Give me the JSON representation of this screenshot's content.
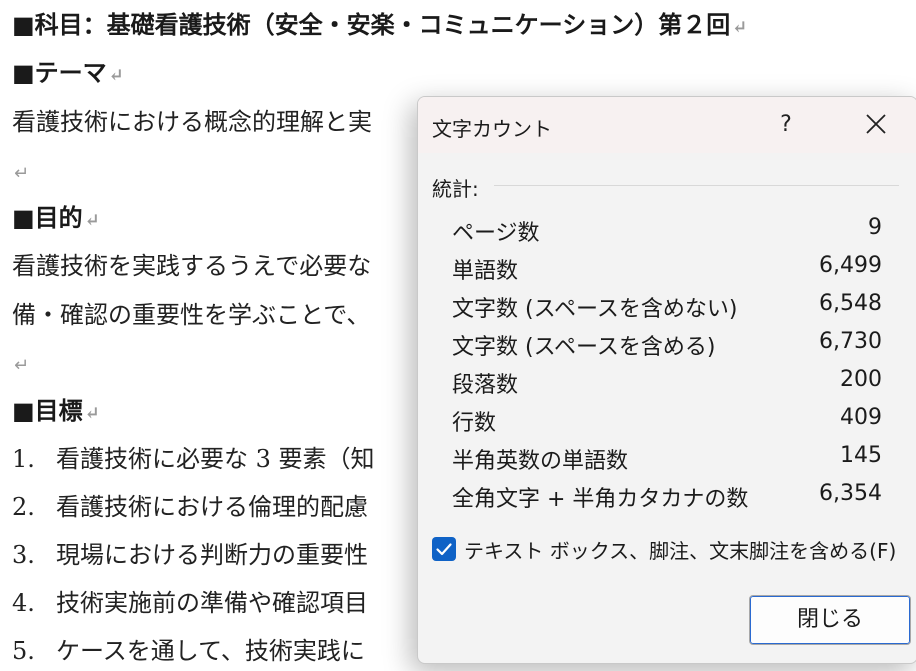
{
  "document": {
    "lines": [
      {
        "text": "■科目：基礎看護技術（安全・安楽・コミュニケーション）第２回",
        "mark": "↵"
      },
      {
        "text": "■テーマ",
        "mark": "↵"
      },
      {
        "text": "看護技術における概念的理解と実",
        "mark": ""
      },
      {
        "text": "",
        "mark": "↵"
      },
      {
        "text": "■目的",
        "mark": "↵"
      },
      {
        "text": "看護技術を実践するうえで必要な",
        "mark": ""
      },
      {
        "text": "備・確認の重要性を学ぶことで、",
        "mark": ""
      },
      {
        "text": "",
        "mark": "↵"
      },
      {
        "text": "■目標",
        "mark": "↵"
      }
    ],
    "goals": [
      {
        "num": "1.",
        "text": "看護技術に必要な 3 要素（知"
      },
      {
        "num": "2.",
        "text": "看護技術における倫理的配慮"
      },
      {
        "num": "3.",
        "text": "現場における判断力の重要性"
      },
      {
        "num": "4.",
        "text": "技術実施前の準備や確認項目"
      },
      {
        "num": "5.",
        "text": "ケースを通して、技術実践に"
      }
    ]
  },
  "dialog": {
    "title": "文字カウント",
    "help_label": "?",
    "section_label": "統計:",
    "stats": [
      {
        "label": "ページ数",
        "value": "9"
      },
      {
        "label": "単語数",
        "value": "6,499"
      },
      {
        "label": "文字数 (スペースを含めない)",
        "value": "6,548"
      },
      {
        "label": "文字数 (スペースを含める)",
        "value": "6,730"
      },
      {
        "label": "段落数",
        "value": "200"
      },
      {
        "label": "行数",
        "value": "409"
      },
      {
        "label": "半角英数の単語数",
        "value": "145"
      },
      {
        "label": "全角文字 + 半角カタカナの数",
        "value": "6,354"
      }
    ],
    "checkbox_label": "テキスト ボックス、脚注、文末脚注を含める(F)",
    "checkbox_checked": true,
    "close_button_label": "閉じる"
  },
  "colors": {
    "accent": "#0f62c6",
    "dialog_bg": "#f3f3f3"
  }
}
